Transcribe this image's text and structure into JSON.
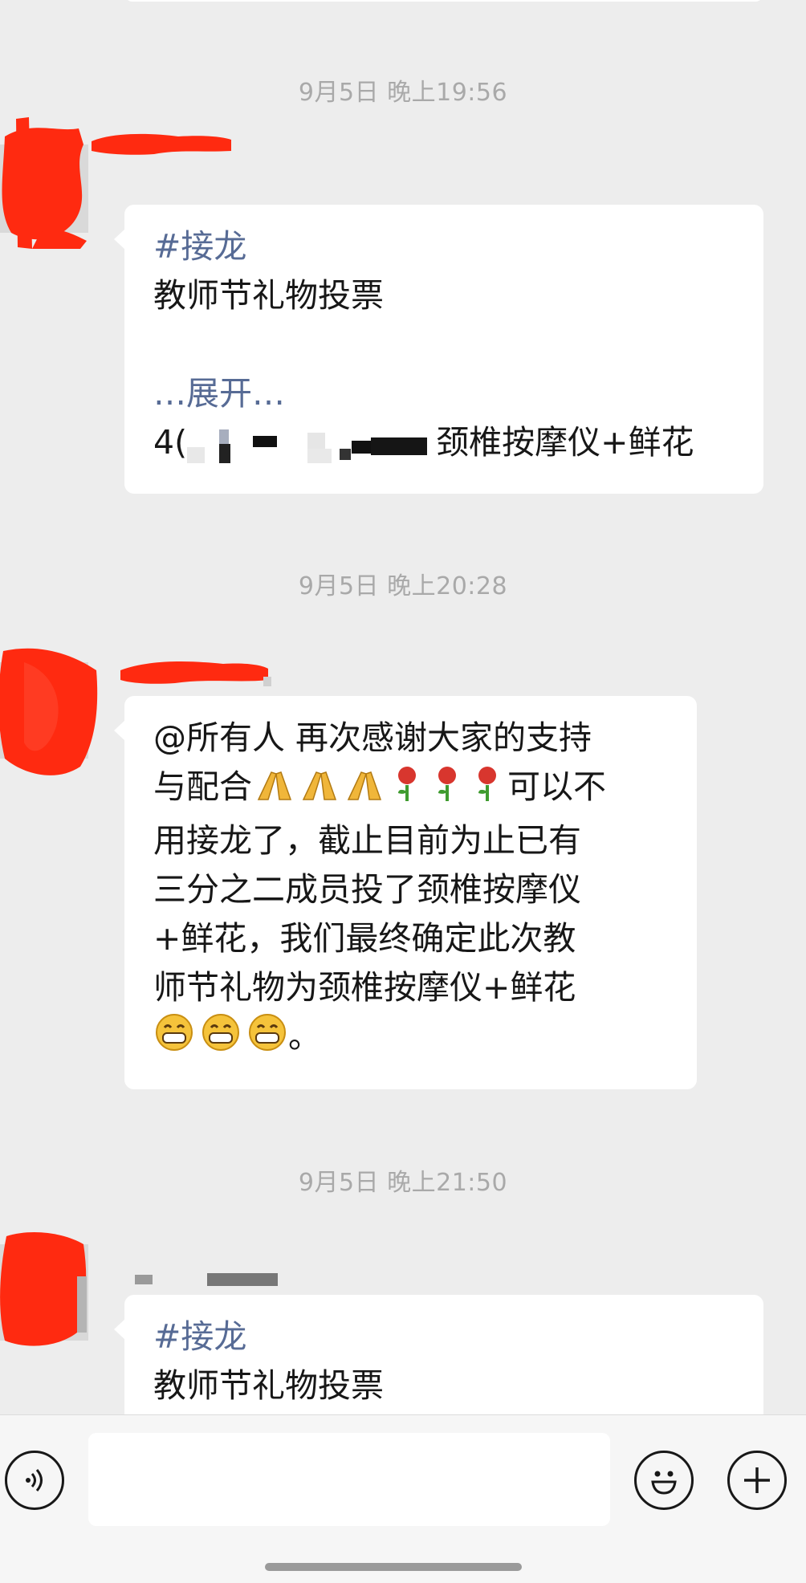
{
  "messages": [
    {
      "timestamp": "9月5日 晚上19:56",
      "tag": "#接龙",
      "lines": [
        "教师节礼物投票"
      ],
      "expand": "…展开…",
      "entry_prefix": "4(",
      "entry_suffix": "颈椎按摩仪+鲜花"
    },
    {
      "timestamp": "9月5日 晚上20:28",
      "lines": [
        "@所有人  再次感谢大家的支持",
        "与配合",
        "可以不",
        "用接龙了，截止目前为止已有",
        "三分之二成员投了颈椎按摩仪",
        "+鲜花，我们最终确定此次教",
        "师节礼物为颈椎按摩仪+鲜花",
        "。"
      ],
      "emoji": {
        "pray": "pray-emoji",
        "rose": "rose-emoji",
        "grin": "grin-emoji"
      }
    },
    {
      "timestamp": "9月5日 晚上21:50",
      "tag": "#接龙",
      "lines": [
        "教师节礼物投票"
      ]
    }
  ],
  "input_bar": {
    "voice_icon": "voice-icon",
    "emoji_icon": "smiley-icon",
    "plus_icon": "plus-icon",
    "input_value": ""
  },
  "colors": {
    "background": "#ededed",
    "bubble": "#ffffff",
    "link_blue": "#576b95",
    "timestamp_gray": "#a9a9a9",
    "redaction_red": "#ff2a10"
  }
}
